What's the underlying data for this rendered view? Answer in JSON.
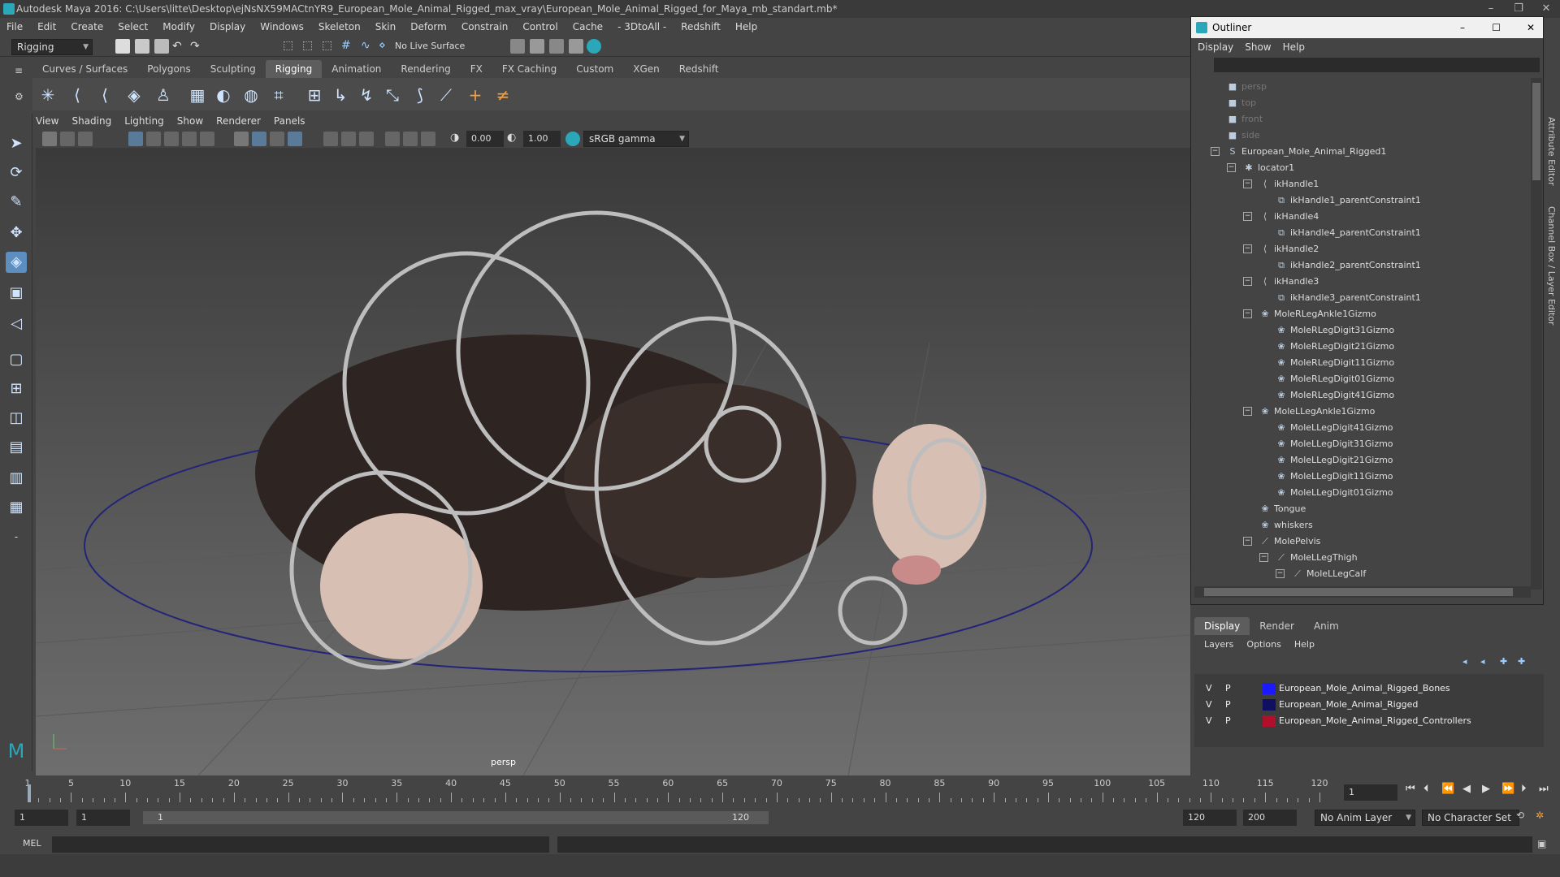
{
  "window": {
    "title": "Autodesk Maya 2016: C:\\Users\\litte\\Desktop\\ejNsNX59MACtnYR9_European_Mole_Animal_Rigged_max_vray\\European_Mole_Animal_Rigged_for_Maya_mb_standart.mb*"
  },
  "menubar": [
    "File",
    "Edit",
    "Create",
    "Select",
    "Modify",
    "Display",
    "Windows",
    "Skeleton",
    "Skin",
    "Deform",
    "Constrain",
    "Control",
    "Cache",
    "- 3DtoAll -",
    "Redshift",
    "Help"
  ],
  "statusline": {
    "mode": "Rigging",
    "live_surface": "No Live Surface"
  },
  "shelf_tabs": [
    "Curves / Surfaces",
    "Polygons",
    "Sculpting",
    "Rigging",
    "Animation",
    "Rendering",
    "FX",
    "FX Caching",
    "Custom",
    "XGen",
    "Redshift"
  ],
  "active_shelf": "Rigging",
  "panel_menu": [
    "View",
    "Shading",
    "Lighting",
    "Show",
    "Renderer",
    "Panels"
  ],
  "panel_toolbar": {
    "exposure": "0.00",
    "gamma": "1.00",
    "color_space": "sRGB gamma"
  },
  "viewport": {
    "camera_label": "persp"
  },
  "outliner": {
    "title": "Outliner",
    "menu": [
      "Display",
      "Show",
      "Help"
    ],
    "items": [
      {
        "label": "persp",
        "depth": 0,
        "icon": "camera-icon",
        "dim": true,
        "exp": ""
      },
      {
        "label": "top",
        "depth": 0,
        "icon": "camera-icon",
        "dim": true,
        "exp": ""
      },
      {
        "label": "front",
        "depth": 0,
        "icon": "camera-icon",
        "dim": true,
        "exp": ""
      },
      {
        "label": "side",
        "depth": 0,
        "icon": "camera-icon",
        "dim": true,
        "exp": ""
      },
      {
        "label": "European_Mole_Animal_Rigged1",
        "depth": 0,
        "icon": "curve-icon",
        "dim": false,
        "exp": "-"
      },
      {
        "label": "locator1",
        "depth": 1,
        "icon": "locator-icon",
        "dim": false,
        "exp": "-"
      },
      {
        "label": "ikHandle1",
        "depth": 2,
        "icon": "ikhandle-icon",
        "dim": false,
        "exp": "-"
      },
      {
        "label": "ikHandle1_parentConstraint1",
        "depth": 3,
        "icon": "constraint-icon",
        "dim": false,
        "exp": ""
      },
      {
        "label": "ikHandle4",
        "depth": 2,
        "icon": "ikhandle-icon",
        "dim": false,
        "exp": "-"
      },
      {
        "label": "ikHandle4_parentConstraint1",
        "depth": 3,
        "icon": "constraint-icon",
        "dim": false,
        "exp": ""
      },
      {
        "label": "ikHandle2",
        "depth": 2,
        "icon": "ikhandle-icon",
        "dim": false,
        "exp": "-"
      },
      {
        "label": "ikHandle2_parentConstraint1",
        "depth": 3,
        "icon": "constraint-icon",
        "dim": false,
        "exp": ""
      },
      {
        "label": "ikHandle3",
        "depth": 2,
        "icon": "ikhandle-icon",
        "dim": false,
        "exp": "-"
      },
      {
        "label": "ikHandle3_parentConstraint1",
        "depth": 3,
        "icon": "constraint-icon",
        "dim": false,
        "exp": ""
      },
      {
        "label": "MoleRLegAnkle1Gizmo",
        "depth": 2,
        "icon": "gizmo-icon",
        "dim": false,
        "exp": "-"
      },
      {
        "label": "MoleRLegDigit31Gizmo",
        "depth": 3,
        "icon": "gizmo-icon",
        "dim": false,
        "exp": ""
      },
      {
        "label": "MoleRLegDigit21Gizmo",
        "depth": 3,
        "icon": "gizmo-icon",
        "dim": false,
        "exp": ""
      },
      {
        "label": "MoleRLegDigit11Gizmo",
        "depth": 3,
        "icon": "gizmo-icon",
        "dim": false,
        "exp": ""
      },
      {
        "label": "MoleRLegDigit01Gizmo",
        "depth": 3,
        "icon": "gizmo-icon",
        "dim": false,
        "exp": ""
      },
      {
        "label": "MoleRLegDigit41Gizmo",
        "depth": 3,
        "icon": "gizmo-icon",
        "dim": false,
        "exp": ""
      },
      {
        "label": "MoleLLegAnkle1Gizmo",
        "depth": 2,
        "icon": "gizmo-icon",
        "dim": false,
        "exp": "-"
      },
      {
        "label": "MoleLLegDigit41Gizmo",
        "depth": 3,
        "icon": "gizmo-icon",
        "dim": false,
        "exp": ""
      },
      {
        "label": "MoleLLegDigit31Gizmo",
        "depth": 3,
        "icon": "gizmo-icon",
        "dim": false,
        "exp": ""
      },
      {
        "label": "MoleLLegDigit21Gizmo",
        "depth": 3,
        "icon": "gizmo-icon",
        "dim": false,
        "exp": ""
      },
      {
        "label": "MoleLLegDigit11Gizmo",
        "depth": 3,
        "icon": "gizmo-icon",
        "dim": false,
        "exp": ""
      },
      {
        "label": "MoleLLegDigit01Gizmo",
        "depth": 3,
        "icon": "gizmo-icon",
        "dim": false,
        "exp": ""
      },
      {
        "label": "Tongue",
        "depth": 2,
        "icon": "gizmo-icon",
        "dim": false,
        "exp": ""
      },
      {
        "label": "whiskers",
        "depth": 2,
        "icon": "gizmo-icon",
        "dim": false,
        "exp": ""
      },
      {
        "label": "MolePelvis",
        "depth": 2,
        "icon": "joint-icon",
        "dim": false,
        "exp": "-"
      },
      {
        "label": "MoleLLegThigh",
        "depth": 3,
        "icon": "joint-icon",
        "dim": false,
        "exp": "-"
      },
      {
        "label": "MoleLLegCalf",
        "depth": 4,
        "icon": "joint-icon",
        "dim": false,
        "exp": "-"
      }
    ]
  },
  "layer_editor": {
    "tabs": [
      "Display",
      "Render",
      "Anim"
    ],
    "active_tab": "Display",
    "menu": [
      "Layers",
      "Options",
      "Help"
    ],
    "layers": [
      {
        "v": "V",
        "p": "P",
        "color": "#1a1aff",
        "name": "European_Mole_Animal_Rigged_Bones"
      },
      {
        "v": "V",
        "p": "P",
        "color": "#101060",
        "name": "European_Mole_Animal_Rigged"
      },
      {
        "v": "V",
        "p": "P",
        "color": "#b0102a",
        "name": "European_Mole_Animal_Rigged_Controllers"
      }
    ]
  },
  "right_sidebar": [
    "Attribute Editor",
    "Channel Box / Layer Editor"
  ],
  "timeline": {
    "tick_labels": [
      1,
      5,
      10,
      15,
      20,
      25,
      30,
      35,
      40,
      45,
      50,
      55,
      60,
      65,
      70,
      75,
      80,
      85,
      90,
      95,
      100,
      105,
      110,
      115,
      120
    ],
    "current_frame": "1"
  },
  "range": {
    "start": "1",
    "playback_start": "1",
    "slider_start": "1",
    "slider_end": "120",
    "playback_end": "120",
    "end": "200",
    "anim_layer": "No Anim Layer",
    "character_set": "No Character Set"
  },
  "command_line": {
    "label": "MEL"
  }
}
